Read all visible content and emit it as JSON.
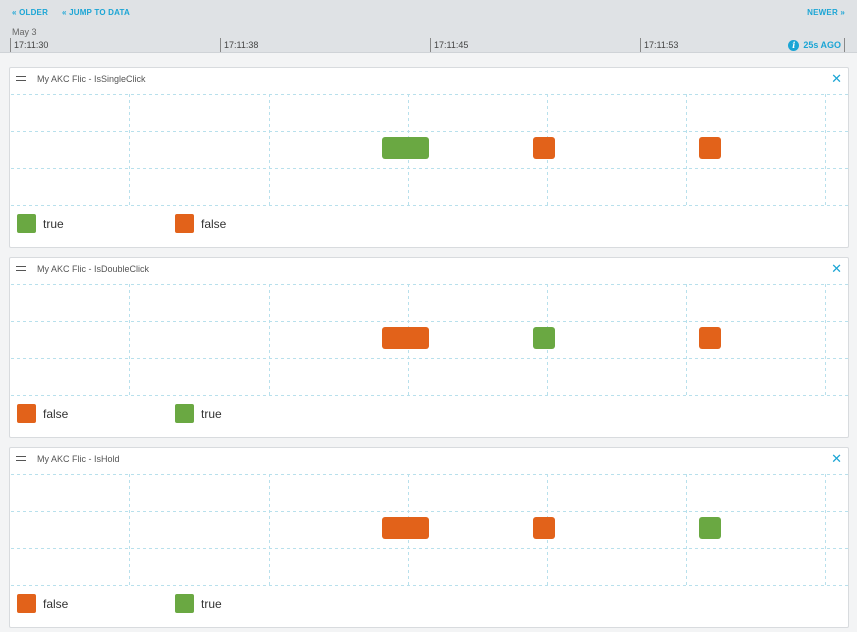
{
  "nav": {
    "older": "« OLDER",
    "jump": "« JUMP TO DATA",
    "newer": "NEWER »"
  },
  "timeline": {
    "date": "May 3",
    "ticks": [
      "17:11:30",
      "17:11:38",
      "17:11:45",
      "17:11:53"
    ],
    "ago": "25s AGO",
    "info_icon": "info-icon"
  },
  "colors": {
    "true": "#6aa842",
    "false": "#e2621a",
    "accent": "#1ba5d5",
    "grid": "#b8e0ec"
  },
  "panels": [
    {
      "title": "My AKC Flic - IsSingleClick",
      "legend": [
        {
          "label": "true",
          "state": "true"
        },
        {
          "label": "false",
          "state": "false"
        }
      ],
      "events": [
        {
          "state": "true",
          "kind": "wide"
        },
        {
          "state": "false",
          "kind": "narrow"
        },
        {
          "state": "false",
          "kind": "narrow"
        }
      ]
    },
    {
      "title": "My AKC Flic - IsDoubleClick",
      "legend": [
        {
          "label": "false",
          "state": "false"
        },
        {
          "label": "true",
          "state": "true"
        }
      ],
      "events": [
        {
          "state": "false",
          "kind": "wide"
        },
        {
          "state": "true",
          "kind": "narrow"
        },
        {
          "state": "false",
          "kind": "narrow"
        }
      ]
    },
    {
      "title": "My AKC Flic - IsHold",
      "legend": [
        {
          "label": "false",
          "state": "false"
        },
        {
          "label": "true",
          "state": "true"
        }
      ],
      "events": [
        {
          "state": "false",
          "kind": "wide"
        },
        {
          "state": "false",
          "kind": "narrow"
        },
        {
          "state": "true",
          "kind": "narrow"
        }
      ]
    }
  ]
}
